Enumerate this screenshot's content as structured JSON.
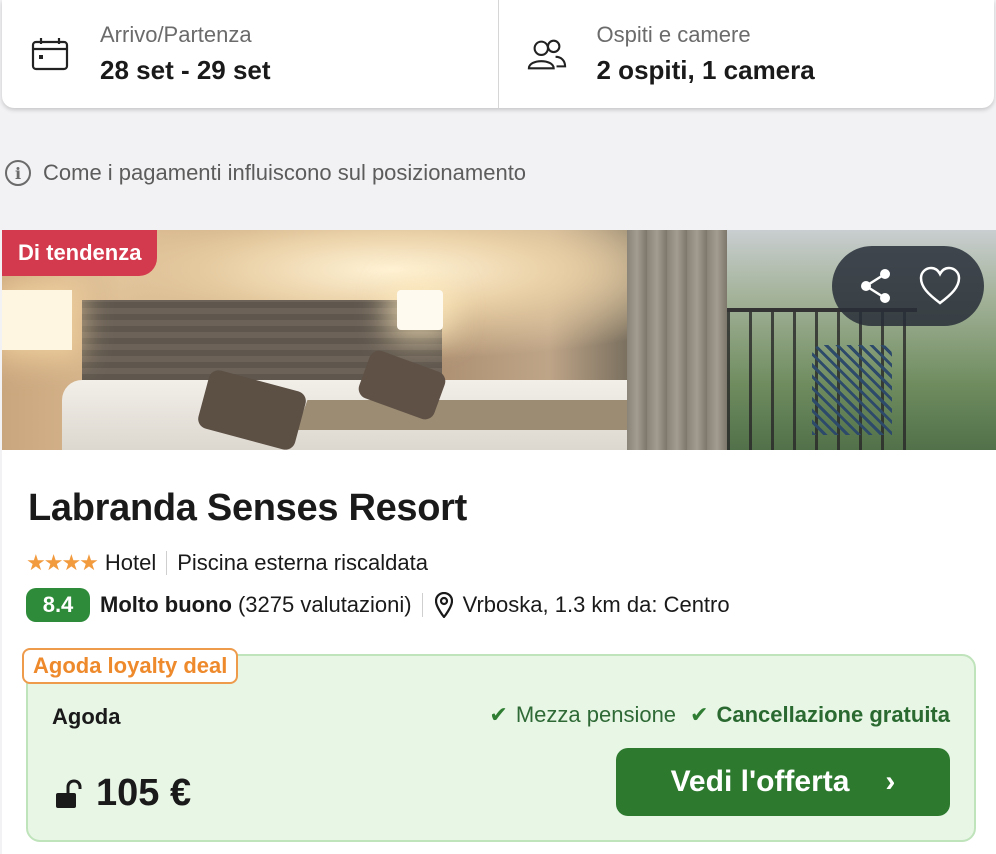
{
  "search": {
    "dates_caption": "Arrivo/Partenza",
    "dates_value": "28 set - 29 set",
    "guests_caption": "Ospiti e camere",
    "guests_value": "2 ospiti, 1 camera"
  },
  "info_line": {
    "icon": "info-icon",
    "text": "Come i pagamenti influiscono sul posizionamento"
  },
  "hotel": {
    "badge": "Di tendenza",
    "name": "Labranda Senses Resort",
    "stars_glyph": "★★★★",
    "stars": 4,
    "type": "Hotel",
    "amenity": "Piscina esterna riscaldata",
    "score": "8.4",
    "score_label": "Molto buono",
    "reviews": "(3275 valutazioni)",
    "location": "Vrboska, 1.3 km da: Centro"
  },
  "deal": {
    "tag": "Agoda loyalty deal",
    "provider": "Agoda",
    "feature_1": "Mezza pensione",
    "feature_2": "Cancellazione gratuita",
    "check_glyph": "✔",
    "price": "105 €",
    "cta_label": "Vedi l'offerta",
    "cta_chevron": "›"
  },
  "colors": {
    "trend_badge": "#d33a4d",
    "score_badge": "#2e8b3a",
    "star": "#f19a3e",
    "deal_bg": "#e8f6e6",
    "deal_tag": "#ee8a2c",
    "cta": "#2d7a2f"
  }
}
